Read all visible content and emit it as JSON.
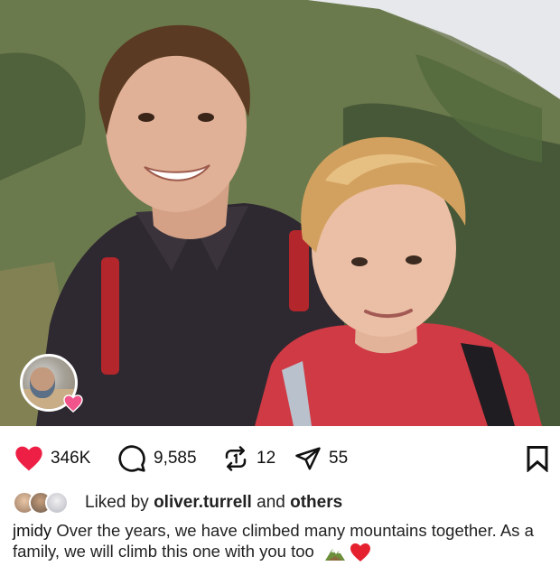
{
  "post": {
    "image_alt": "Vintage photo of two children smiling in front of mountains",
    "likes": "346K",
    "comments": "9,585",
    "reposts": "12",
    "shares": "55"
  },
  "liked_by": {
    "prefix": "Liked by",
    "user": "oliver.turrell",
    "connector": "and",
    "others": "others"
  },
  "caption": {
    "username": "jmidy",
    "text": "Over the years, we have climbed many mountains together. As a family, we will climb this one with you too"
  },
  "colors": {
    "like": "#ed1f45",
    "icon": "#111111"
  },
  "icons": [
    "heart-filled-icon",
    "comment-icon",
    "repost-icon",
    "share-icon",
    "bookmark-icon",
    "mountain-emoji-icon",
    "red-heart-emoji-icon"
  ]
}
